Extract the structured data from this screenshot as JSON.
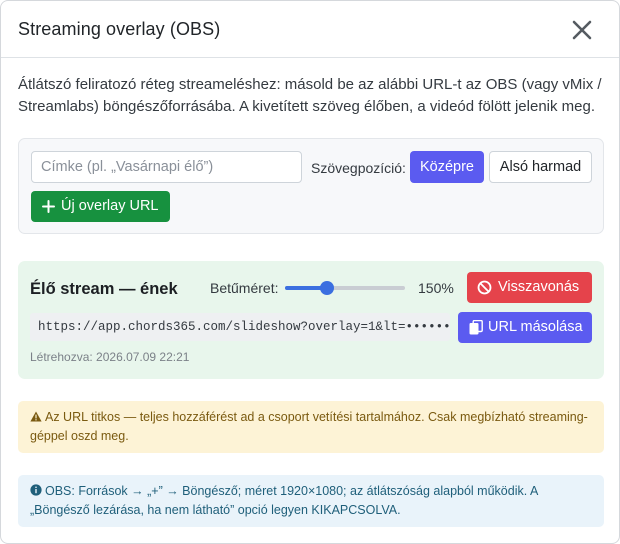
{
  "modal": {
    "title": "Streaming overlay (OBS)",
    "close_icon": "close-icon"
  },
  "intro": {
    "text": "Átlátszó feliratozó réteg streameléshez: másold be az alábbi URL-t az OBS (vagy vMix / Streamlabs) böngészőforrásába. A kivetített szöveg élőben, a videód fölött jelenik meg."
  },
  "create_form": {
    "label_input": {
      "value": "",
      "placeholder": "Címke (pl. „Vasárnapi élő”)"
    },
    "text_position_label": "Szövegpozíció:",
    "position_options": [
      {
        "label": "Középre",
        "selected": true
      },
      {
        "label": "Alsó harmad",
        "selected": false
      }
    ],
    "new_overlay_label": "Új overlay URL",
    "new_overlay_icon": "plus-icon"
  },
  "overlays": [
    {
      "name": "Élő stream — ének",
      "font_size_label": "Betűméret:",
      "font_size_percent": 150,
      "font_size_display": "150%",
      "font_size_slider_fraction": 0.33,
      "revoke_label": "Visszavonás",
      "revoke_icon": "ban-icon",
      "url": "https://app.chords365.com/slideshow?overlay=1&lt=••••••••",
      "copy_label": "URL másolása",
      "copy_icon": "copy-icon",
      "created": "Létrehozva: 2026.07.09 22:21"
    }
  ],
  "warning": {
    "icon": "warning-icon",
    "text": "Az URL titkos — teljes hozzáférést ad a csoport vetítési tartalmához. Csak megbízható streaming-géppel oszd meg."
  },
  "info": {
    "icon": "info-icon",
    "text": "OBS: Források → „+” → Böngésző; méret 1920×1080; az átlátszóság alapból működik. A „Böngésző lezárása, ha nem látható” opció legyen KIKAPCSOLVA."
  },
  "colors": {
    "primary": "#5b5bf0",
    "success": "#17913f",
    "danger": "#e5434b",
    "overlay_card_bg": "#e8f6ec",
    "warning_bg": "#fdf3d6",
    "info_bg": "#e9f3fa"
  }
}
